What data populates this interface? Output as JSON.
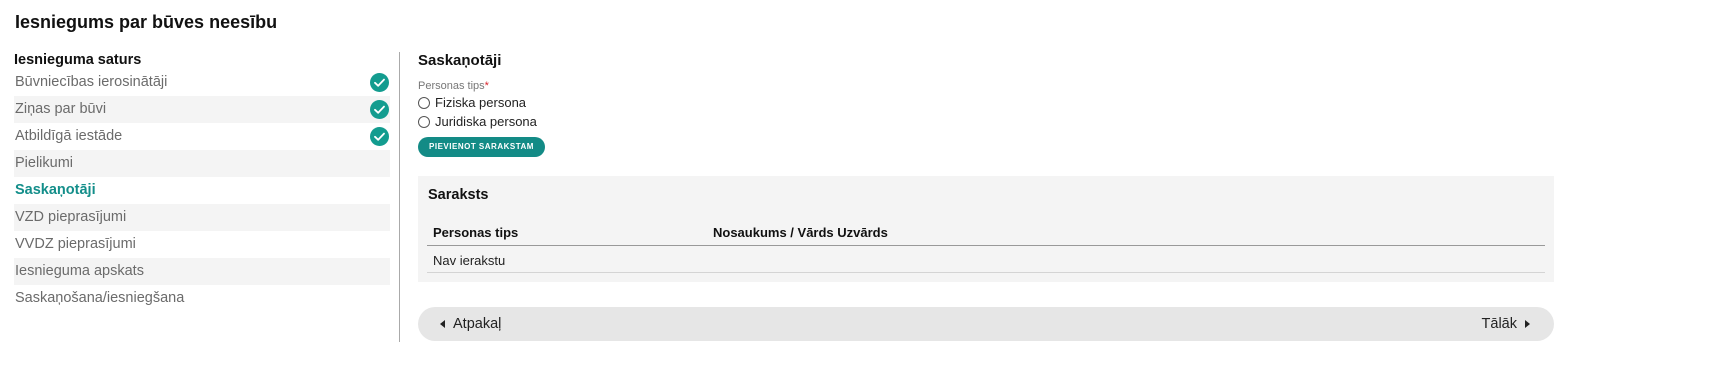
{
  "page": {
    "title": "Iesniegums par būves neesību"
  },
  "sidebar": {
    "heading": "Iesnieguma saturs",
    "items": [
      {
        "label": "Būvniecības ierosinātāji",
        "done": true
      },
      {
        "label": "Ziņas par būvi",
        "done": true
      },
      {
        "label": "Atbildīgā iestāde",
        "done": true
      },
      {
        "label": "Pielikumi",
        "done": false
      },
      {
        "label": "Saskaņotāji",
        "done": false,
        "active": true
      },
      {
        "label": "VZD pieprasījumi",
        "done": false
      },
      {
        "label": "VVDZ pieprasījumi",
        "done": false
      },
      {
        "label": "Iesnieguma apskats",
        "done": false
      },
      {
        "label": "Saskaņošana/iesniegšana",
        "done": false
      }
    ]
  },
  "main": {
    "title": "Saskaņotāji",
    "person_type_label": "Personas tips",
    "required_mark": "*",
    "options": [
      "Fiziska persona",
      "Juridiska persona"
    ],
    "add_button": "PIEVIENOT SARAKSTAM"
  },
  "list": {
    "title": "Saraksts",
    "columns": [
      "Personas tips",
      "Nosaukums / Vārds Uzvārds"
    ],
    "empty_text": "Nav ierakstu"
  },
  "nav": {
    "back": "Atpakaļ",
    "next": "Tālāk"
  },
  "colors": {
    "accent": "#138b86",
    "check": "#139c8f",
    "required": "#d9262d"
  }
}
